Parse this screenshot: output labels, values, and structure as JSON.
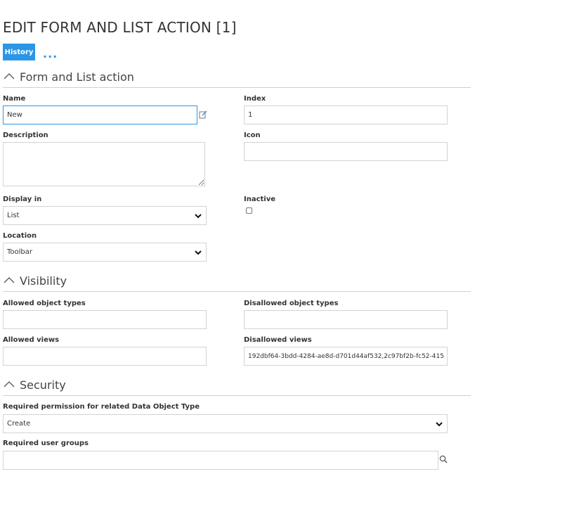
{
  "page": {
    "title": "EDIT FORM AND LIST ACTION [1]"
  },
  "toolbar": {
    "history_label": "History",
    "more_label": "..."
  },
  "sections": {
    "form": "Form and List action",
    "visibility": "Visibility",
    "security": "Security"
  },
  "form": {
    "name_label": "Name",
    "name_value": "New",
    "index_label": "Index",
    "index_value": "1",
    "description_label": "Description",
    "description_value": "",
    "icon_label": "Icon",
    "icon_value": "",
    "display_in_label": "Display in",
    "display_in_value": "List",
    "inactive_label": "Inactive",
    "inactive_checked": false,
    "location_label": "Location",
    "location_value": "Toolbar"
  },
  "visibility": {
    "allowed_types_label": "Allowed object types",
    "allowed_types_value": "",
    "disallowed_types_label": "Disallowed object types",
    "disallowed_types_value": "",
    "allowed_views_label": "Allowed views",
    "allowed_views_value": "",
    "disallowed_views_label": "Disallowed views",
    "disallowed_views_value": "192dbf64-3bdd-4284-ae8d-d701d44af532,2c97bf2b-fc52-415"
  },
  "security": {
    "permission_label": "Required permission for related Data Object Type",
    "permission_value": "Create",
    "user_groups_label": "Required user groups",
    "user_groups_value": ""
  },
  "colors": {
    "accent": "#2b96e8",
    "border": "#d3d3d3"
  },
  "icons": [
    "chevron-up-icon",
    "edit-icon",
    "chevron-down-icon",
    "search-icon"
  ]
}
